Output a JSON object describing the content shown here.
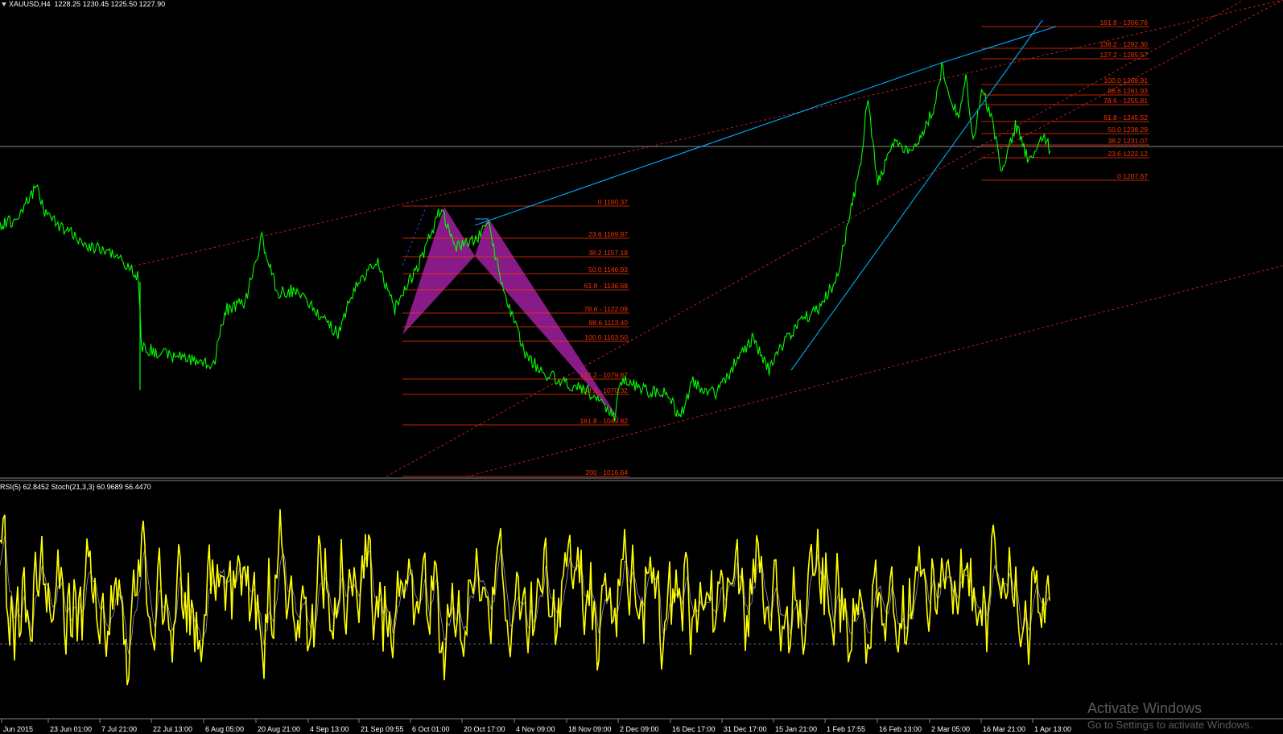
{
  "header": {
    "symbol": "XAUUSD,H4",
    "ohlc": "1228.25 1230.45 1225.50 1227.90"
  },
  "indicator_label": "RSI(5) 62.8452  Stoch(21,3,3) 60.9689 56.4470",
  "colors": {
    "background": "#000000",
    "price_line": "#00ff00",
    "trend_line": "#00aaff",
    "fib_line": "#ff3300",
    "fib_text": "#ff3300",
    "pattern_fill": "#a020a0",
    "rsi_line": "#ffff00",
    "stoch_line": "#8888aa",
    "grid": "#666666"
  },
  "time_axis": [
    "Jun 2015",
    "23 Jun 01:00",
    "7 Jul 21:00",
    "22 Jul 13:00",
    "6 Aug 05:00",
    "20 Aug 21:00",
    "4 Sep 13:00",
    "21 Sep 09:55",
    "6 Oct 01:00",
    "20 Oct 17:00",
    "4 Nov 09:00",
    "18 Nov 09:00",
    "2 Dec 09:00",
    "16 Dec 17:00",
    "31 Dec 17:00",
    "15 Jan 21:00",
    "1 Feb 17:55",
    "16 Feb 13:00",
    "2 Mar 05:00",
    "16 Mar 21:00",
    "1 Apr 13:00"
  ],
  "fib_set_1": [
    {
      "label": "0 1190.37"
    },
    {
      "label": "23.6 1169.87"
    },
    {
      "label": "38.2 1157.18"
    },
    {
      "label": "50.0 1146.93"
    },
    {
      "label": "61.8 - 1136.68"
    },
    {
      "label": "78.6 - 1122.09"
    },
    {
      "label": "88.6 1113.40"
    },
    {
      "label": "100.0 1103.50"
    },
    {
      "label": "127.2 - 1079.87"
    },
    {
      "label": "138.2 - 1070.32"
    },
    {
      "label": "161.8 - 1049.82"
    },
    {
      "label": "200 - 1016.64"
    }
  ],
  "fib_set_2": [
    {
      "label": "161.8 - 1306.76"
    },
    {
      "label": "138.2 - 1292.30"
    },
    {
      "label": "127.2 - 1285.57"
    },
    {
      "label": "100.0 1268.91"
    },
    {
      "label": "88.6 1261.93"
    },
    {
      "label": "78.6 - 1255.81"
    },
    {
      "label": "61.8 - 1245.52"
    },
    {
      "label": "50.0 1238.29"
    },
    {
      "label": "38.2 1231.07"
    },
    {
      "label": "23.6 1222.12"
    },
    {
      "label": "0 1207.67"
    }
  ],
  "watermark": {
    "line1": "Activate Windows",
    "line2": "Go to Settings to activate Windows."
  }
}
